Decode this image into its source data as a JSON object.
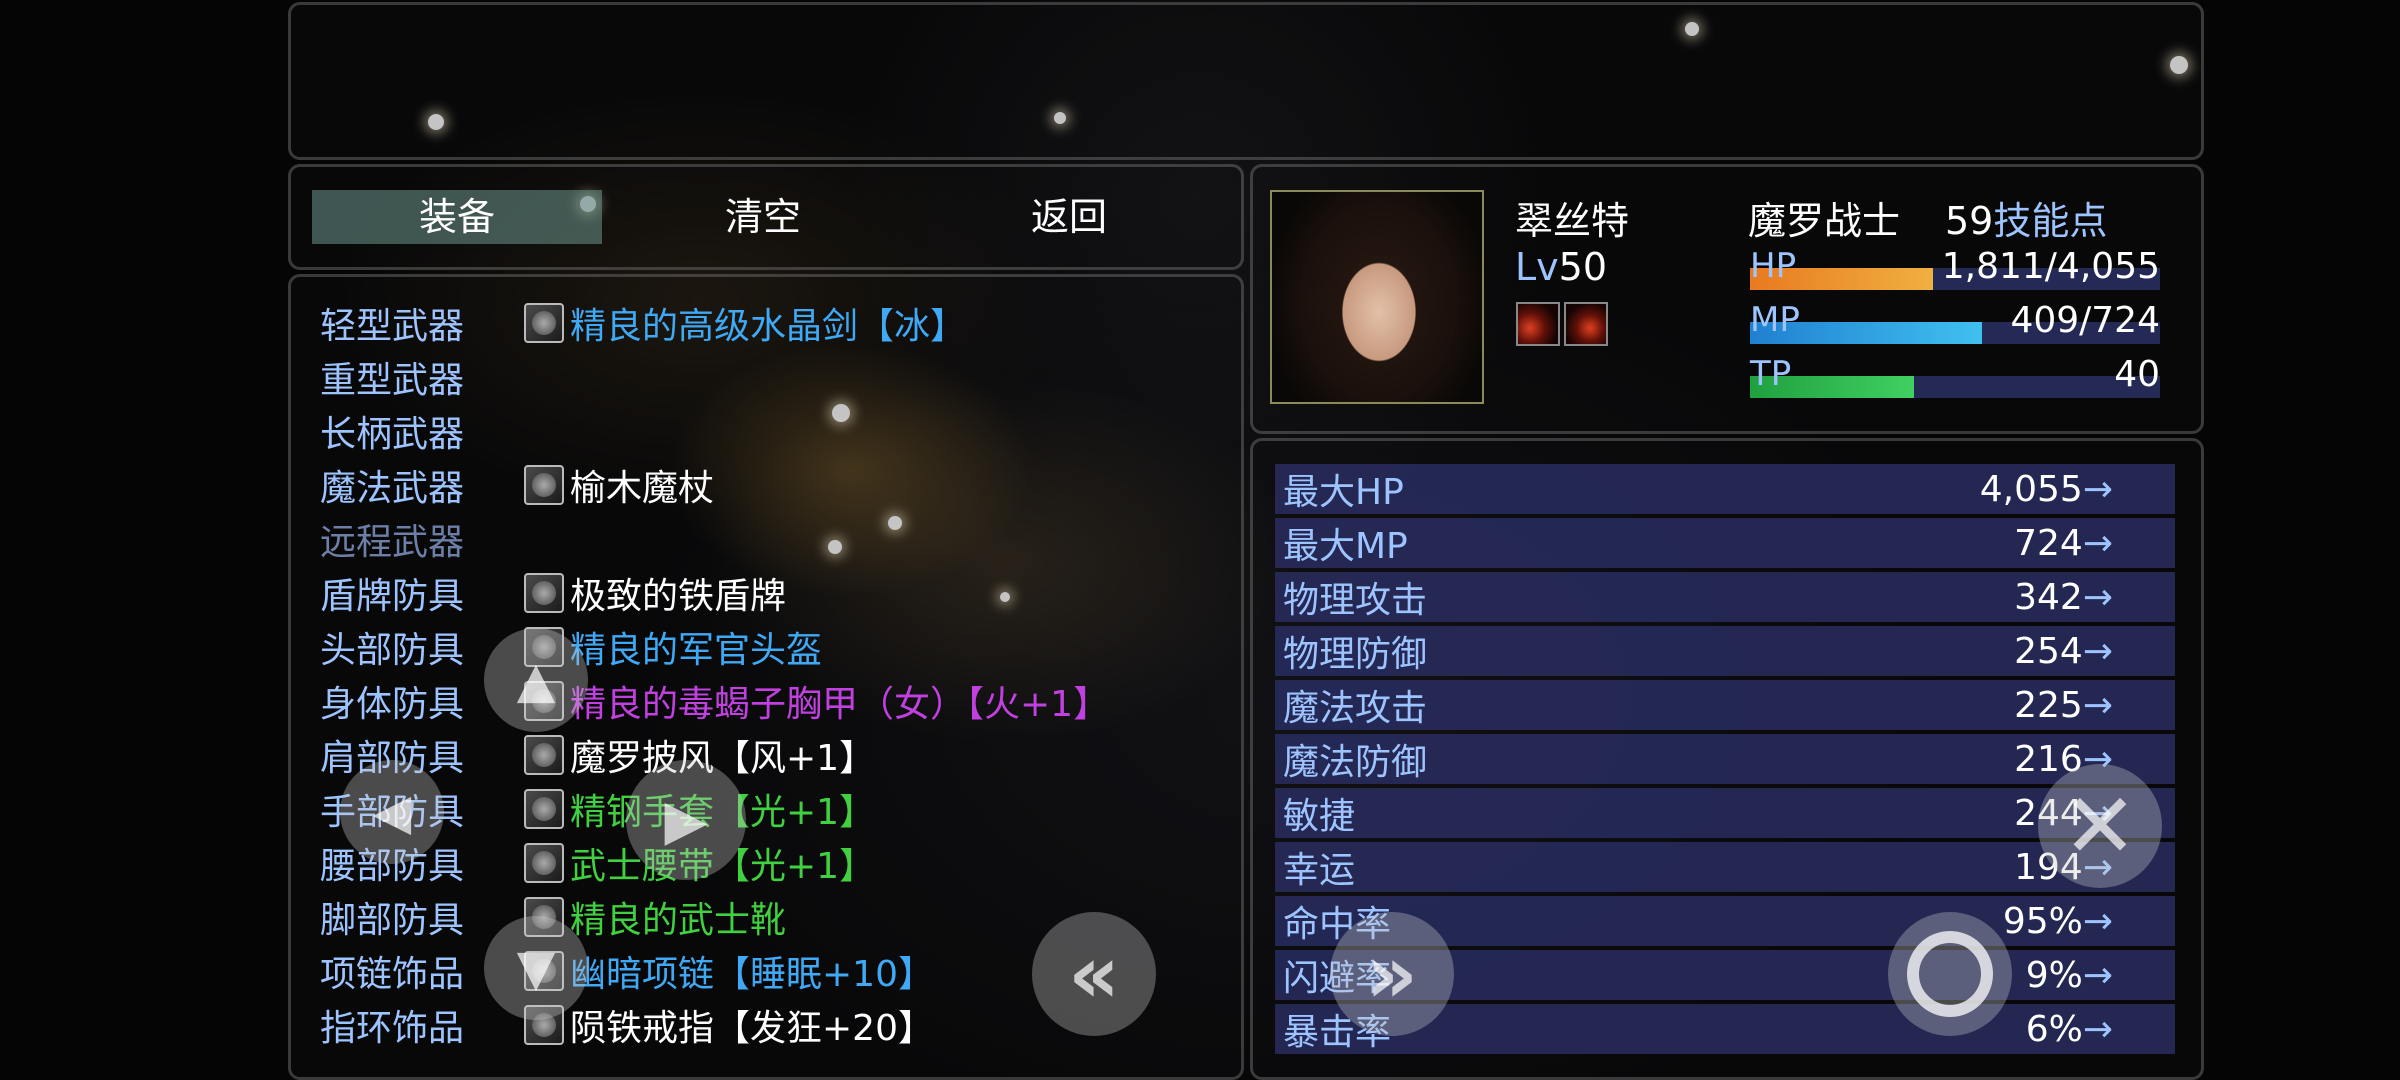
{
  "commands": [
    "装备",
    "清空",
    "返回"
  ],
  "equipment": [
    {
      "slot": "轻型武器",
      "item": "精良的高级水晶剑【冰】",
      "color": "#3fa9f5"
    },
    {
      "slot": "重型武器",
      "item": "",
      "color": "#ffffff"
    },
    {
      "slot": "长柄武器",
      "item": "",
      "color": "#ffffff"
    },
    {
      "slot": "魔法武器",
      "item": "榆木魔杖",
      "color": "#ffffff"
    },
    {
      "slot": "远程武器",
      "item": "",
      "color": "#ffffff"
    },
    {
      "slot": "盾牌防具",
      "item": "极致的铁盾牌",
      "color": "#ffffff"
    },
    {
      "slot": "头部防具",
      "item": "精良的军官头盔",
      "color": "#3fa9f5"
    },
    {
      "slot": "身体防具",
      "item": "精良的毒蝎子胸甲（女）【火+1】",
      "color": "#c040e0"
    },
    {
      "slot": "肩部防具",
      "item": "魔罗披风【风+1】",
      "color": "#ffffff"
    },
    {
      "slot": "手部防具",
      "item": "精钢手套【光+1】",
      "color": "#40d040"
    },
    {
      "slot": "腰部防具",
      "item": "武士腰带【光+1】",
      "color": "#40d040"
    },
    {
      "slot": "脚部防具",
      "item": "精良的武士靴",
      "color": "#40d040"
    },
    {
      "slot": "项链饰品",
      "item": "幽暗项链【睡眠+10】",
      "color": "#3fa9f5"
    },
    {
      "slot": "指环饰品",
      "item": "陨铁戒指【发狂+20】",
      "color": "#ffffff"
    }
  ],
  "actor": {
    "name": "翠丝特",
    "class": "魔罗战士",
    "skill_points": "59",
    "skill_points_label": "技能点",
    "level_label": "Lv",
    "level": "50",
    "hp": {
      "label": "HP",
      "text": "1,811/4,055",
      "fraction": 0.4466,
      "color1": "#e87a20",
      "color2": "#f0b040"
    },
    "mp": {
      "label": "MP",
      "text": "409/724",
      "fraction": 0.565,
      "color1": "#2080d0",
      "color2": "#40c0f0"
    },
    "tp": {
      "label": "TP",
      "text": "40",
      "fraction": 0.4,
      "color1": "#20a040",
      "color2": "#40d060"
    }
  },
  "stats": [
    {
      "name": "最大HP",
      "value": "4,055"
    },
    {
      "name": "最大MP",
      "value": "724"
    },
    {
      "name": "物理攻击",
      "value": "342"
    },
    {
      "name": "物理防御",
      "value": "254"
    },
    {
      "name": "魔法攻击",
      "value": "225"
    },
    {
      "name": "魔法防御",
      "value": "216"
    },
    {
      "name": "敏捷",
      "value": "244"
    },
    {
      "name": "幸运",
      "value": "194"
    },
    {
      "name": "命中率",
      "value": "95%"
    },
    {
      "name": "闪避率",
      "value": "9%"
    },
    {
      "name": "暴击率",
      "value": "6%"
    }
  ],
  "arrow": "→"
}
